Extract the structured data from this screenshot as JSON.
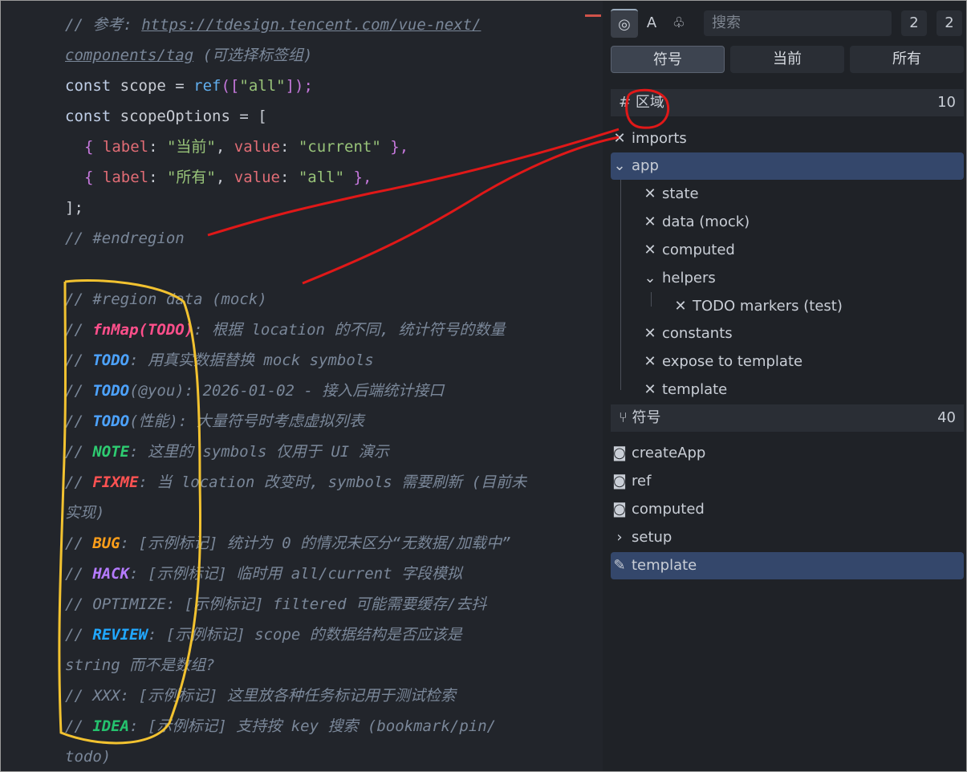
{
  "code": {
    "lines": {
      "l1_comment": "// 参考: ",
      "l1_url": "https://tdesign.tencent.com/vue-next/",
      "l2_url": "components/tag",
      "l2_tail": " (可选择标签组)",
      "l3_kw": "const",
      "l3_rest": " scope = ",
      "l3_fn": "ref",
      "l3_args": "([",
      "l3_str": "\"all\"",
      "l3_end": "]);",
      "l4_kw": "const",
      "l4_rest": " scopeOptions = [",
      "l5_open": "{ ",
      "l5_p1": "label",
      "l5_colon1": ": ",
      "l5_v1": "\"当前\"",
      "l5_comma": ", ",
      "l5_p2": "value",
      "l5_colon2": ": ",
      "l5_v2": "\"current\"",
      "l5_close": " },",
      "l6_open": "{ ",
      "l6_p1": "label",
      "l6_colon1": ": ",
      "l6_v1": "\"所有\"",
      "l6_comma": ", ",
      "l6_p2": "value",
      "l6_colon2": ": ",
      "l6_v2": "\"all\"",
      "l6_close": " },",
      "l7": "];",
      "l8": "// #endregion",
      "l9": "// #region data (mock)",
      "l10_pre": "// ",
      "l10_mark": "fnMap(TODO)",
      "l10_text": ":  根据 location 的不同, 统计符号的数量",
      "l11_pre": "// ",
      "l11_mark": "TODO",
      "l11_text": ": 用真实数据替换 mock symbols",
      "l12_pre": "// ",
      "l12_mark": "TODO",
      "l12_text": "(@you): 2026-01-02 - 接入后端统计接口",
      "l13_pre": "// ",
      "l13_mark": "TODO",
      "l13_text": "(性能): 大量符号时考虑虚拟列表",
      "l14_pre": "// ",
      "l14_mark": "NOTE",
      "l14_text": ": 这里的 symbols 仅用于 UI 演示",
      "l15_pre": "// ",
      "l15_mark": "FIXME",
      "l15_text": ": 当 location 改变时, symbols 需要刷新 (目前未",
      "l16": "实现)",
      "l17_pre": "// ",
      "l17_mark": "BUG",
      "l17_text": ": [示例标记] 统计为 0 的情况未区分“无数据/加载中”",
      "l18_pre": "// ",
      "l18_mark": "HACK",
      "l18_text": ": [示例标记] 临时用 all/current 字段模拟",
      "l19": "// OPTIMIZE: [示例标记] filtered 可能需要缓存/去抖",
      "l20_pre": "// ",
      "l20_mark": "REVIEW",
      "l20_text": ": [示例标记] scope 的数据结构是否应该是",
      "l21": "string 而不是数组?",
      "l22": "// XXX: [示例标记] 这里放各种任务标记用于测试检索",
      "l23_pre": "// ",
      "l23_mark": "IDEA",
      "l23_text": ": [示例标记] 支持按 key 搜索 (bookmark/pin/",
      "l24": "todo)"
    }
  },
  "panel": {
    "toolbar": {
      "btn_outline_glyph": "◎",
      "btn_text_glyph": "A",
      "btn_shapes_glyph": "♧",
      "search_placeholder": "搜索",
      "counter_a": "2",
      "counter_b": "2"
    },
    "tabs": [
      "符号",
      "当前",
      "所有"
    ],
    "regions": {
      "title": "区域",
      "count": "10",
      "items": [
        "imports",
        "app",
        "state",
        "data (mock)",
        "computed",
        "helpers",
        "TODO markers (test)",
        "constants",
        "expose to template",
        "template"
      ]
    },
    "symbols": {
      "title": "符号",
      "count": "40",
      "items": [
        "createApp",
        "ref",
        "computed",
        "setup",
        "template"
      ]
    }
  },
  "colors": {
    "annotation_red": "#e01818",
    "annotation_yellow": "#f2c230",
    "selection": "#34476b"
  }
}
